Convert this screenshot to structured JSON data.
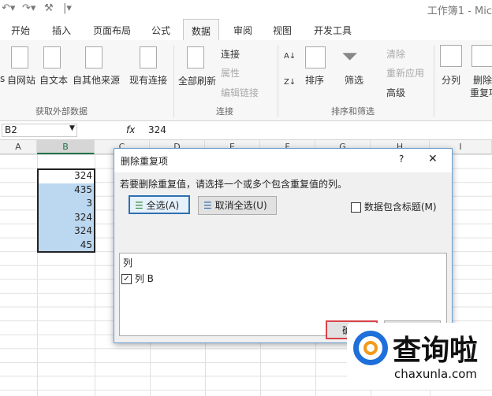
{
  "qat": {
    "title": "工作簿1 - Mic"
  },
  "tabs": [
    "开始",
    "插入",
    "页面布局",
    "公式",
    "数据",
    "审阅",
    "视图",
    "开发工具"
  ],
  "active_tab": "数据",
  "ribbon": {
    "get_external": {
      "items": [
        "s",
        "自网站",
        "自文本",
        "自其他来源",
        "现有连接"
      ],
      "label": "获取外部数据"
    },
    "connections": {
      "refresh_all": "全部刷新",
      "connections": "连接",
      "properties": "属性",
      "edit_links": "编辑链接",
      "label": "连接"
    },
    "sort_filter": {
      "sort": "排序",
      "filter": "筛选",
      "clear": "清除",
      "reapply": "重新应用",
      "advanced": "高级",
      "label": "排序和筛选"
    },
    "tools": {
      "split": "分列",
      "remove_dup_1": "删除",
      "remove_dup_2": "重复项"
    }
  },
  "formula_bar": {
    "name_box": "B2",
    "fx": "fx",
    "value": "324"
  },
  "columns": [
    "A",
    "B",
    "C",
    "D",
    "E",
    "F",
    "G",
    "H",
    "I"
  ],
  "cells_b": [
    "324",
    "435",
    "3",
    "324",
    "324",
    "45"
  ],
  "dialog": {
    "title": "删除重复项",
    "help": "?",
    "close": "✕",
    "instruction": "若要删除重复值，请选择一个或多个包含重复值的列。",
    "select_all": "全选(A)",
    "unselect_all": "取消全选(U)",
    "has_headers": "数据包含标题(M)",
    "has_headers_checked": false,
    "list_header": "列",
    "columns": [
      {
        "label": "列 B",
        "checked": true
      }
    ],
    "ok": "确定",
    "cancel": "取消"
  },
  "watermark": {
    "text": "查询啦",
    "url": "chaxunla.com"
  }
}
